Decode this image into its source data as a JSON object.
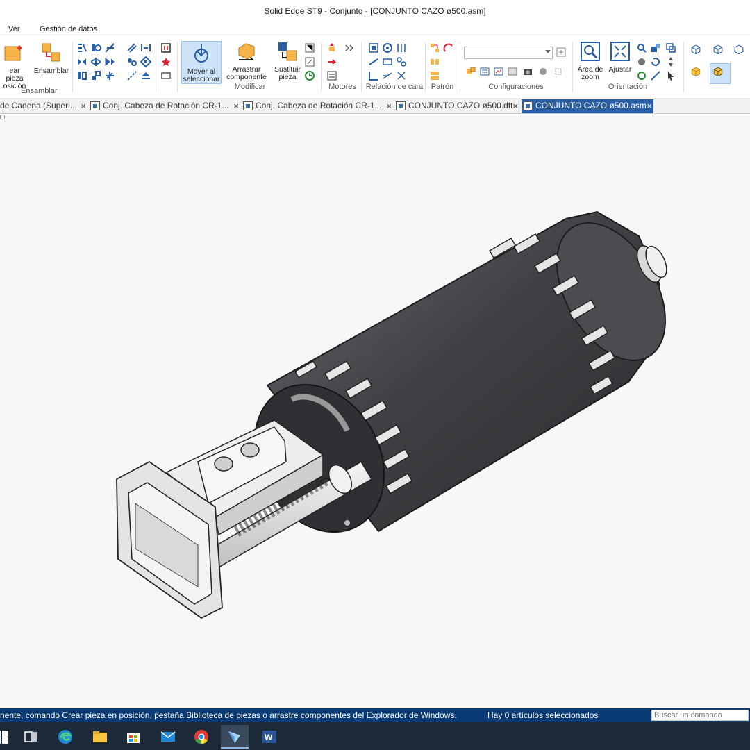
{
  "window": {
    "title": "Solid Edge ST9 - Conjunto - [CONJUNTO CAZO ø500.asm]"
  },
  "menu": {
    "ver": "Ver",
    "gestion": "Gestión de datos"
  },
  "ribbon": {
    "ensamblar": {
      "crear_label_1": "ear pieza",
      "crear_label_2": "osición",
      "ensamblar_label": "Ensamblar",
      "group_label": "Ensamblar"
    },
    "modificar": {
      "mover_1": "Mover al",
      "mover_2": "seleccionar",
      "arrastrar_1": "Arrastrar",
      "arrastrar_2": "componente",
      "sustituir_1": "Sustituir",
      "sustituir_2": "pieza",
      "group_label": "Modificar"
    },
    "motores": {
      "group_label": "Motores"
    },
    "relacion": {
      "group_label": "Relación de cara"
    },
    "patron": {
      "group_label": "Patrón"
    },
    "configuraciones": {
      "group_label": "Configuraciones",
      "combo_value": ""
    },
    "orientacion": {
      "area_1": "Área de",
      "area_2": "zoom",
      "ajustar": "Ajustar",
      "group_label": "Orientación"
    }
  },
  "tabs": [
    {
      "label": "de Cadena (Superi...",
      "close": "×"
    },
    {
      "label": "Conj. Cabeza de Rotación CR-1...",
      "close": "×"
    },
    {
      "label": "Conj. Cabeza de Rotación CR-1...",
      "close": "×"
    },
    {
      "label": "CONJUNTO CAZO ø500.dft",
      "close": "×"
    },
    {
      "label": "CONJUNTO CAZO ø500.asm",
      "close": "×",
      "active": true
    }
  ],
  "status": {
    "message": "nente, comando Crear pieza en posición, pestaña Biblioteca de piezas o arrastre componentes del Explorador de Windows.",
    "selection": "Hay 0 artículos seleccionados",
    "search_placeholder": "Buscar un comando"
  },
  "colors": {
    "status_bg": "#0a3a73",
    "active_tab": "#2a5fa5",
    "taskbar": "#1c2a3a",
    "model_body": "#3f4144"
  },
  "taskbar": [
    "windows-icon",
    "task-view-icon",
    "edge-icon",
    "file-explorer-icon",
    "store-icon",
    "mail-icon",
    "chrome-icon",
    "solid-edge-icon",
    "word-icon"
  ]
}
